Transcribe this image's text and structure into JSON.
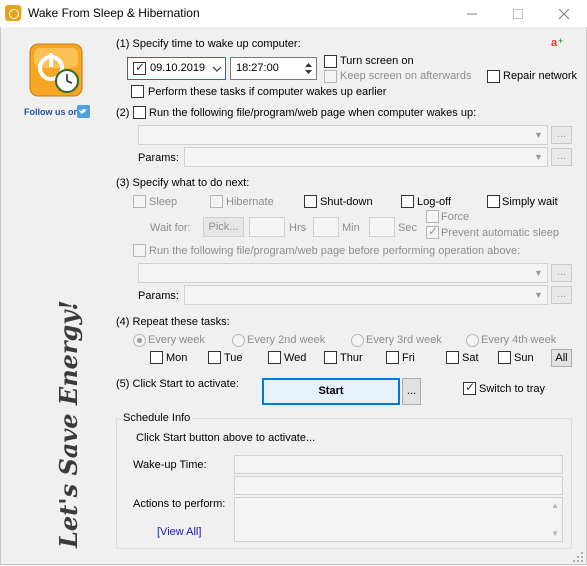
{
  "window": {
    "title": "Wake From Sleep & Hibernation",
    "minimize_icon": "minimize-icon",
    "maximize_icon": "maximize-icon",
    "close_icon": "close-icon"
  },
  "sidebar": {
    "follow_text": "Follow us on",
    "slogan": "Let's Save Energy!"
  },
  "section1": {
    "heading": "(1) Specify time to wake up computer:",
    "date_value": "09.10.2019",
    "time_value": "18:27:00",
    "turn_screen_on": "Turn screen on",
    "keep_screen_on": "Keep screen on afterwards",
    "repair_network": "Repair network",
    "perform_if_wakes": "Perform these tasks if computer wakes up earlier"
  },
  "section2": {
    "run_label": "Run the following file/program/web page when computer wakes up:",
    "section_num": "(2)",
    "params_label": "Params:",
    "dots": "..."
  },
  "section3": {
    "heading": "(3) Specify what to do next:",
    "sleep": "Sleep",
    "hibernate": "Hibernate",
    "shutdown": "Shut-down",
    "logoff": "Log-off",
    "simply_wait": "Simply wait",
    "wait_for": "Wait for:",
    "pick": "Pick...",
    "hrs": "Hrs",
    "min": "Min",
    "sec": "Sec",
    "force": "Force",
    "prevent_sleep": "Prevent automatic sleep",
    "run_before": "Run the following file/program/web page before performing operation above:",
    "params_label": "Params:",
    "dots": "..."
  },
  "section4": {
    "heading": "(4) Repeat these tasks:",
    "every_week": "Every week",
    "every_2nd_week": "Every 2nd week",
    "every_3rd_week": "Every 3rd week",
    "every_4th_week": "Every 4th week",
    "days": [
      "Mon",
      "Tue",
      "Wed",
      "Thur",
      "Fri",
      "Sat",
      "Sun"
    ],
    "all_button": "All"
  },
  "section5": {
    "heading": "(5) Click Start to activate:",
    "start_button": "Start",
    "dots": "...",
    "switch_to_tray": "Switch to tray"
  },
  "schedule": {
    "legend": "Schedule Info",
    "message": "Click Start button above to activate...",
    "wakeup_label": "Wake-up Time:",
    "actions_label": "Actions to perform:",
    "view_all": "[View All]"
  },
  "colors": {
    "accent_blue": "#0078d7",
    "link_blue": "#1a1aa0",
    "logo_orange": "#e8a21a"
  }
}
